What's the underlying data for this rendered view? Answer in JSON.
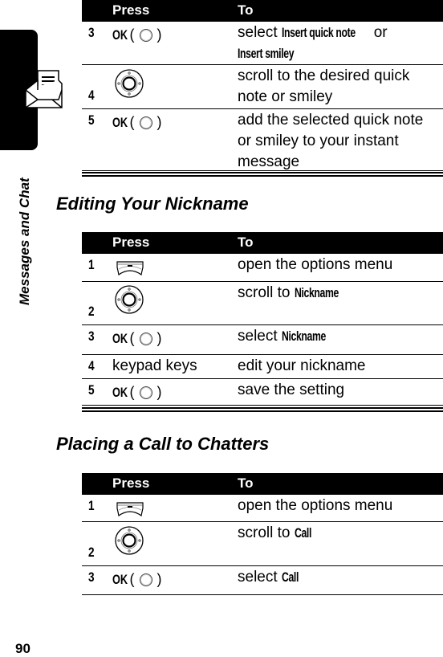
{
  "sidebar": {
    "label": "Messages and Chat",
    "icon": "envelope-letter-icon"
  },
  "table_headers": {
    "press": "Press",
    "to": "To"
  },
  "table1": {
    "rows": [
      {
        "num": "3",
        "press": {
          "type": "ok",
          "label": "OK"
        },
        "to": [
          {
            "t": "select "
          },
          {
            "b": "Insert quick note"
          },
          {
            "t": " or "
          },
          {
            "b": "Insert smiley"
          }
        ]
      },
      {
        "num": "4",
        "press": {
          "type": "nav-key"
        },
        "to": [
          {
            "t": "scroll to the desired quick note or smiley"
          }
        ]
      },
      {
        "num": "5",
        "press": {
          "type": "ok",
          "label": "OK"
        },
        "to": [
          {
            "t": "add the selected quick note or smiley to your instant message"
          }
        ]
      }
    ]
  },
  "section2": {
    "title": "Editing Your Nickname",
    "rows": [
      {
        "num": "1",
        "press": {
          "type": "menu-key"
        },
        "to": [
          {
            "t": "open the options menu"
          }
        ]
      },
      {
        "num": "2",
        "press": {
          "type": "nav-key"
        },
        "to": [
          {
            "t": "scroll to "
          },
          {
            "b": "Nickname"
          }
        ]
      },
      {
        "num": "3",
        "press": {
          "type": "ok",
          "label": "OK"
        },
        "to": [
          {
            "t": "select "
          },
          {
            "b": "Nickname"
          }
        ]
      },
      {
        "num": "4",
        "press": {
          "type": "text",
          "label": "keypad keys"
        },
        "to": [
          {
            "t": "edit your nickname"
          }
        ]
      },
      {
        "num": "5",
        "press": {
          "type": "ok",
          "label": "OK"
        },
        "to": [
          {
            "t": "save the setting"
          }
        ]
      }
    ]
  },
  "section3": {
    "title": "Placing a Call to Chatters",
    "rows": [
      {
        "num": "1",
        "press": {
          "type": "menu-key"
        },
        "to": [
          {
            "t": "open the options menu"
          }
        ]
      },
      {
        "num": "2",
        "press": {
          "type": "nav-key"
        },
        "to": [
          {
            "t": "scroll to "
          },
          {
            "b": "Call"
          }
        ]
      },
      {
        "num": "3",
        "press": {
          "type": "ok",
          "label": "OK"
        },
        "to": [
          {
            "t": "select "
          },
          {
            "b": "Call"
          }
        ]
      }
    ]
  },
  "page_number": "90"
}
